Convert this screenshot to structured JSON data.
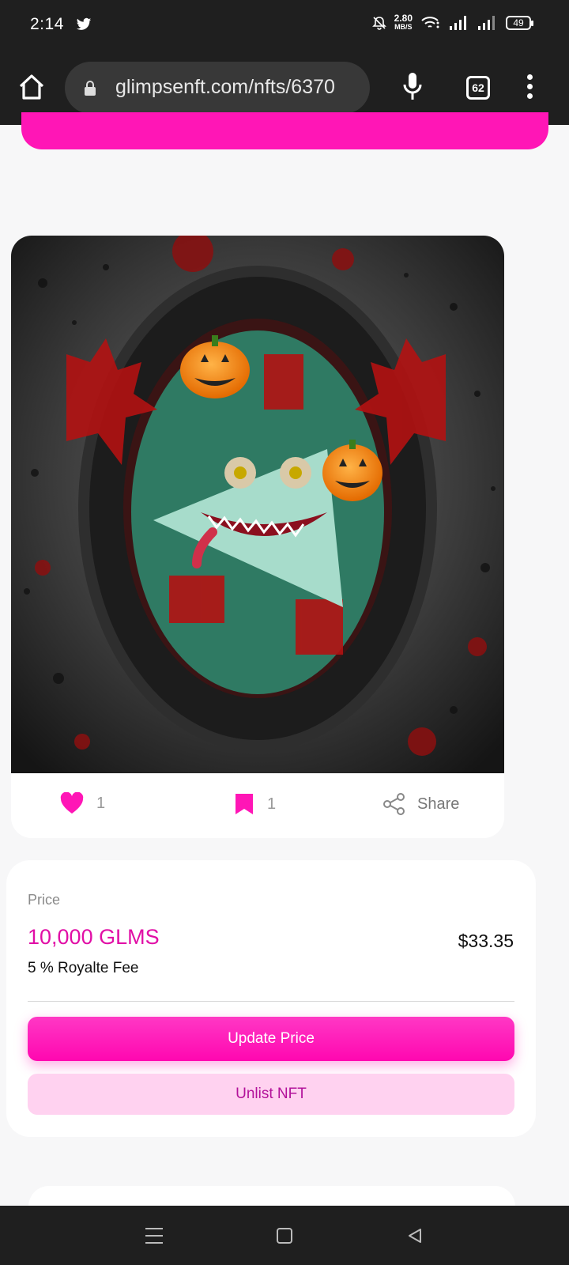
{
  "status_bar": {
    "time": "2:14",
    "net_speed": "2.80",
    "net_unit": "MB/S",
    "battery": "49"
  },
  "browser": {
    "url": "glimpsenft.com/nfts/6370",
    "tabs_count": "62"
  },
  "nft": {
    "likes": "1",
    "bookmarks": "1",
    "share_label": "Share"
  },
  "price": {
    "label": "Price",
    "value": "10,000 GLMS",
    "usd": "$33.35",
    "royalty": "5 %  Royalte Fee",
    "update_button": "Update Price",
    "unlist_button": "Unlist NFT"
  },
  "colors": {
    "accent": "#ff16b6",
    "price_text": "#e10ea6",
    "unlist_bg": "#ffd2f0"
  }
}
